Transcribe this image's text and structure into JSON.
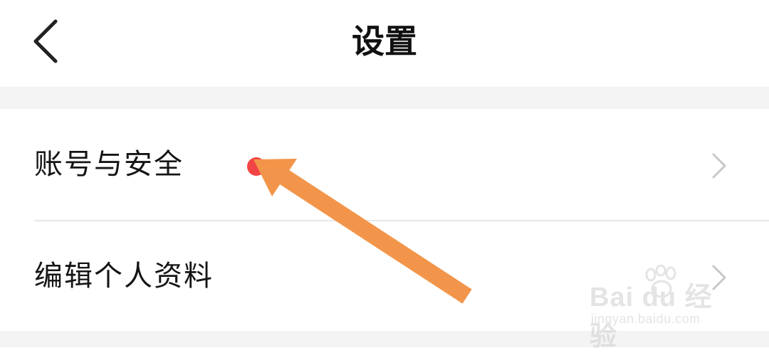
{
  "header": {
    "title": "设置",
    "back_icon": "chevron-left-icon"
  },
  "settings": {
    "items": [
      {
        "label": "账号与安全",
        "icon": "chevron-right-icon",
        "has_red_dot": false
      },
      {
        "label": "编辑个人资料",
        "icon": "chevron-right-icon",
        "has_red_dot": true
      }
    ]
  },
  "annotation": {
    "arrow_color": "#F2954A"
  },
  "watermark": {
    "logo": "Bai du 经验",
    "url": "jingyan.baidu.com"
  },
  "colors": {
    "section_bg": "#F4F4F4",
    "red_dot": "#F24444",
    "chevron": "#C8C8C8"
  }
}
